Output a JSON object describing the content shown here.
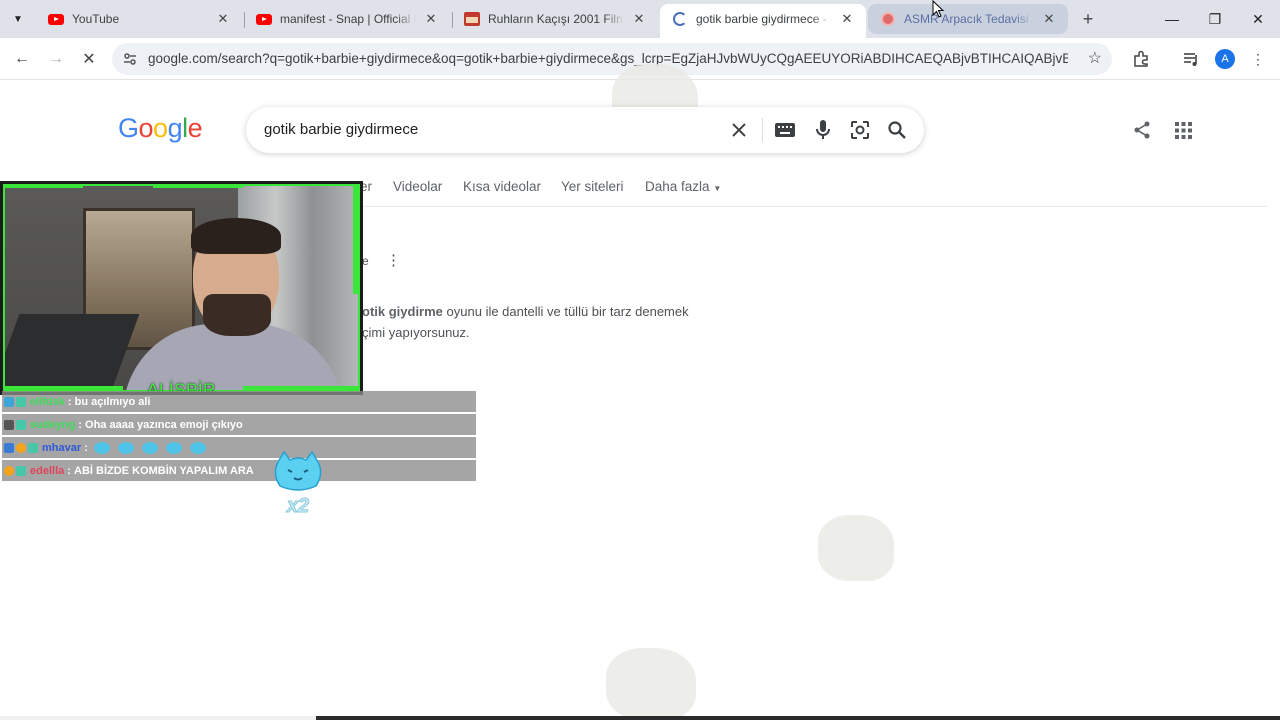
{
  "browser": {
    "tabs": [
      {
        "title": "YouTube",
        "favicon": "youtube-icon"
      },
      {
        "title": "manifest - Snap | Official Da",
        "favicon": "youtube-icon"
      },
      {
        "title": "Ruhların Kaçışı 2001 Filmi Fu",
        "favicon": "film-site-icon"
      },
      {
        "title": "gotik barbie giydirmece - G",
        "favicon": "google-icon"
      },
      {
        "title": "ASMR Arpacık Tedavisi - Oy",
        "favicon": "asmr-site-icon"
      }
    ],
    "active_tab_index": 3,
    "url": "google.com/search?q=gotik+barbie+giydirmece&oq=gotik+barbie+giydirmece&gs_lcrp=EgZjaHJvbWUyCQgAEEUYORiABDIHCAEQABjvBTIHCAIQABjvBTIHC...",
    "profile_initial": "A"
  },
  "google": {
    "logo_text": "Google",
    "logo_colors": [
      "#4285F4",
      "#EA4335",
      "#FBBC05",
      "#4285F4",
      "#34A853",
      "#EA4335"
    ],
    "query": "gotik barbie giydirmece",
    "nav": {
      "partial": "er",
      "videolar": "Videolar",
      "kisa": "Kısa videolar",
      "yer": "Yer siteleri",
      "daha": "Daha fazla"
    },
    "result": {
      "source_partial": "e",
      "line1_bold": "otik giydirme",
      "line1_rest": " oyunu ile dantelli ve tüllü bir tarz denemek",
      "line2": "çimi yapıyorsunuz."
    }
  },
  "stream": {
    "streamer_name": "ALİSPİR",
    "chat": [
      {
        "user": "elifdsk",
        "user_color": "#3ddc5a",
        "message": "bu açılmıyo ali"
      },
      {
        "user": "sudeyng",
        "user_color": "#3ddc5a",
        "message": "Oha aaaa yazınca emoji çıkıyo"
      },
      {
        "user": "mhavar",
        "user_color": "#2f59d6",
        "message": "",
        "emotes": 5
      },
      {
        "user": "edellla",
        "user_color": "#e0455a",
        "message": "ABİ BİZDE KOMBİN YAPALIM ARA"
      }
    ],
    "sticker_text": "x2"
  }
}
